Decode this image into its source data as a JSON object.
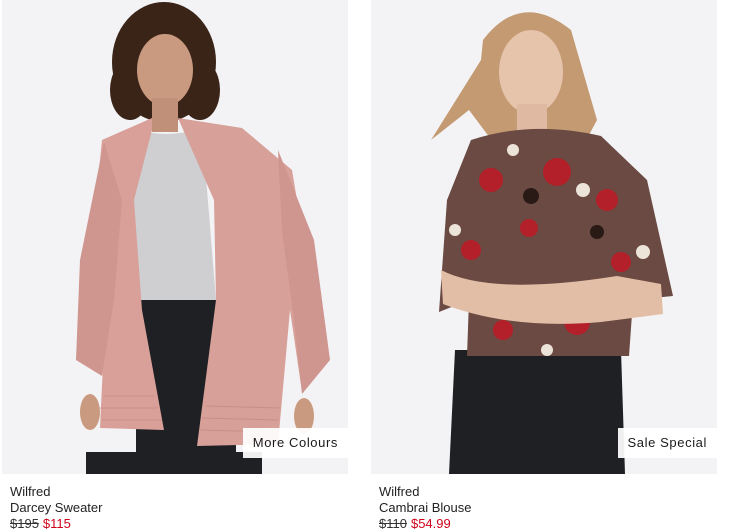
{
  "products": [
    {
      "brand": "Wilfred",
      "name": "Darcey Sweater",
      "price_original": "$195",
      "price_sale": "$115",
      "tag": "More Colours"
    },
    {
      "brand": "Wilfred",
      "name": "Cambrai Blouse",
      "price_original": "$110",
      "price_sale": "$54.99",
      "tag": "Sale Special"
    }
  ],
  "colors": {
    "sale_price": "#d0021b",
    "photo_background": "#f3f3f5",
    "sweater": "#d9a09a",
    "blouse_base": "#6a4a42",
    "blouse_floral": "#b3202a",
    "jeans": "#1f2023"
  }
}
